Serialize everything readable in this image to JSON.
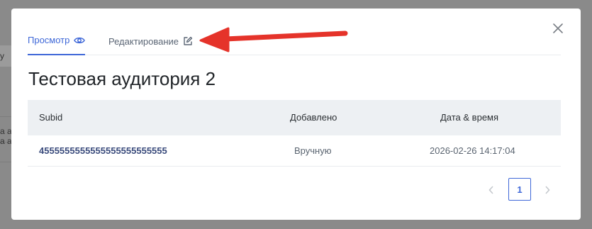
{
  "background_fragments": [
    "у",
    "а ау",
    "а ау"
  ],
  "modal": {
    "tabs": [
      {
        "label": "Просмотр",
        "icon": "eye-icon",
        "active": true
      },
      {
        "label": "Редактирование",
        "icon": "edit-icon",
        "active": false
      }
    ],
    "title": "Тестовая аудитория 2",
    "table": {
      "columns": [
        "Subid",
        "Добавлено",
        "Дата & время"
      ],
      "rows": [
        {
          "subid": "4555555555555555555555555",
          "added": "Вручную",
          "datetime": "2026-02-26 14:17:04"
        }
      ]
    },
    "pagination": {
      "current_page": "1"
    }
  },
  "colors": {
    "accent": "#3f68d8",
    "annotation_arrow": "#e5332a"
  }
}
